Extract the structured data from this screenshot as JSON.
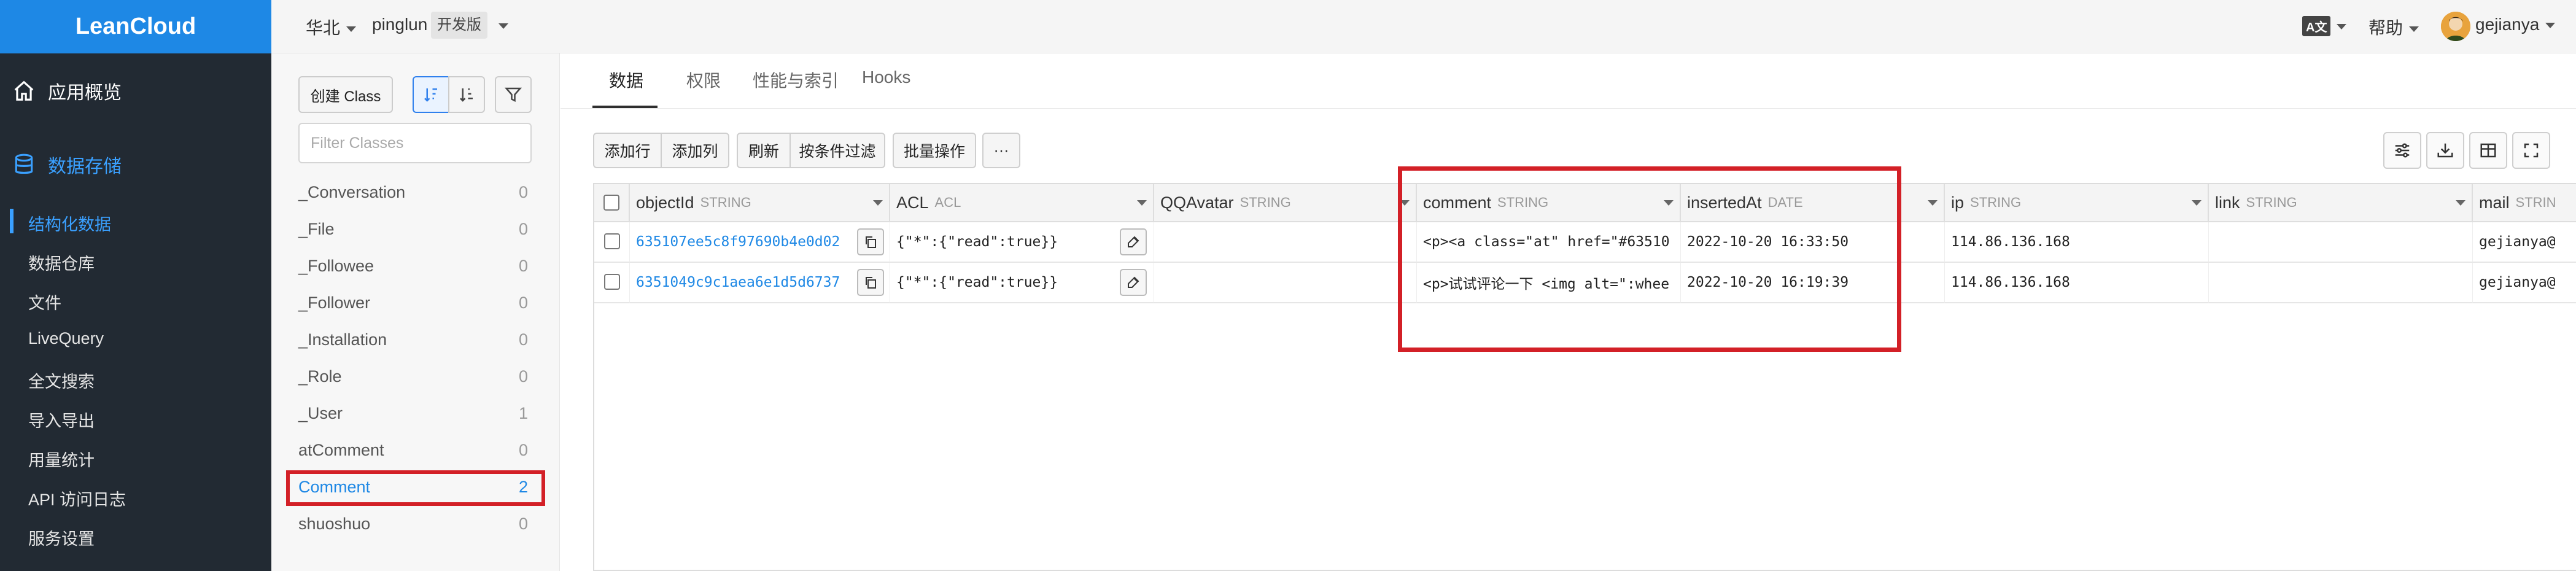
{
  "brand": "LeanCloud",
  "topbar": {
    "region": "华北",
    "app_name": "pinglun",
    "env_badge": "开发版",
    "lang_icon": "A文",
    "help": "帮助",
    "user": "gejianya"
  },
  "sidebar": {
    "overview": "应用概览",
    "storage": "数据存储",
    "items": [
      {
        "label": "结构化数据",
        "active": true
      },
      {
        "label": "数据仓库"
      },
      {
        "label": "文件"
      },
      {
        "label": "LiveQuery"
      },
      {
        "label": "全文搜索"
      },
      {
        "label": "导入导出"
      },
      {
        "label": "用量统计"
      },
      {
        "label": "API 访问日志"
      },
      {
        "label": "服务设置"
      }
    ]
  },
  "classpanel": {
    "create_label": "创建 Class",
    "filter_placeholder": "Filter Classes",
    "classes": [
      {
        "name": "_Conversation",
        "count": "0"
      },
      {
        "name": "_File",
        "count": "0"
      },
      {
        "name": "_Followee",
        "count": "0"
      },
      {
        "name": "_Follower",
        "count": "0"
      },
      {
        "name": "_Installation",
        "count": "0"
      },
      {
        "name": "_Role",
        "count": "0"
      },
      {
        "name": "_User",
        "count": "1"
      },
      {
        "name": "atComment",
        "count": "0"
      },
      {
        "name": "Comment",
        "count": "2",
        "active": true
      },
      {
        "name": "shuoshuo",
        "count": "0"
      }
    ]
  },
  "tabs": [
    "数据",
    "权限",
    "性能与索引",
    "Hooks"
  ],
  "toolbar": {
    "add_row": "添加行",
    "add_col": "添加列",
    "refresh": "刷新",
    "filter": "按条件过滤",
    "batch": "批量操作",
    "more": "···"
  },
  "columns": [
    {
      "name": "objectId",
      "type": "STRING"
    },
    {
      "name": "ACL",
      "type": "ACL"
    },
    {
      "name": "QQAvatar",
      "type": "STRING"
    },
    {
      "name": "comment",
      "type": "STRING"
    },
    {
      "name": "insertedAt",
      "type": "DATE"
    },
    {
      "name": "ip",
      "type": "STRING"
    },
    {
      "name": "link",
      "type": "STRING"
    },
    {
      "name": "mail",
      "type": "STRIN"
    }
  ],
  "rows": [
    {
      "objectId": "635107ee5c8f97690b4e0d02",
      "acl": "{\"*\":{\"read\":true}}",
      "comment": "<p><a class=\"at\" href=\"#63510",
      "insertedAt": "2022-10-20 16:33:50",
      "ip": "114.86.136.168",
      "mail": "gejianya@"
    },
    {
      "objectId": "6351049c9c1aea6e1d5d6737",
      "acl": "{\"*\":{\"read\":true}}",
      "comment": "<p>试试评论一下 <img alt=\":whee",
      "insertedAt": "2022-10-20 16:19:39",
      "ip": "114.86.136.168",
      "mail": "gejianya@"
    }
  ],
  "colors": {
    "accent": "#1e88e5",
    "sidebar_bg": "#222a33",
    "highlight": "#d32027"
  }
}
